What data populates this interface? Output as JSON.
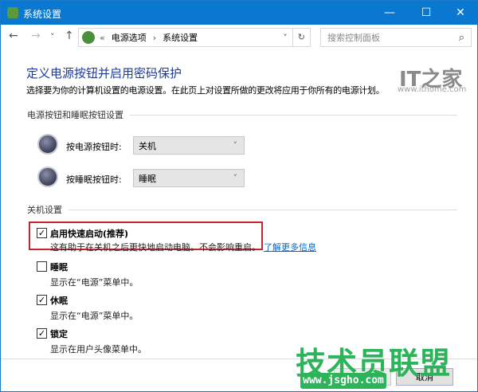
{
  "window": {
    "title": "系统设置",
    "minimize": "—",
    "maximize": "☐",
    "close": "✕"
  },
  "nav": {
    "back": "←",
    "forward": "→",
    "recent": "˅",
    "up": "↑"
  },
  "address": {
    "prefix": "«",
    "crumbs": [
      "电源选项",
      "系统设置"
    ],
    "sep": "›",
    "dropdown": "˅",
    "refresh": "↻"
  },
  "search": {
    "placeholder": "搜索控制面板",
    "icon": "⌕"
  },
  "page": {
    "heading": "定义电源按钮并启用密码保护",
    "description": "选择要为你的计算机设置的电源设置。在此页上对设置所做的更改将应用于你所有的电源计划。"
  },
  "buttons_section": {
    "title": "电源按钮和睡眠按钮设置",
    "power_label": "按电源按钮时:",
    "power_value": "关机",
    "sleep_label": "按睡眠按钮时:",
    "sleep_value": "睡眠"
  },
  "shutdown_section": {
    "title": "关机设置",
    "items": [
      {
        "label": "启用快速启动(推荐)",
        "desc": "这有助于在关机之后更快地启动电脑。不会影响重启。",
        "checked": true,
        "link": "了解更多信息"
      },
      {
        "label": "睡眠",
        "desc": "显示在“电源”菜单中。",
        "checked": false
      },
      {
        "label": "休眠",
        "desc": "显示在“电源”菜单中。",
        "checked": true
      },
      {
        "label": "锁定",
        "desc": "显示在用户头像菜单中。",
        "checked": true
      }
    ]
  },
  "footer": {
    "save": "保存修改",
    "cancel": "取消"
  },
  "watermarks": {
    "ithome_logo": "IT之家",
    "ithome_url": "www.ithome.com",
    "jsgho_logo": "技术员联盟",
    "jsgho_url": "www.jsgho.com"
  },
  "check_mark": "✓",
  "colors": {
    "titlebar": "#0a78d0",
    "heading": "#1e3c96",
    "link": "#0066cc",
    "highlight": "#c4262e",
    "watermark_green": "#2db35a"
  }
}
